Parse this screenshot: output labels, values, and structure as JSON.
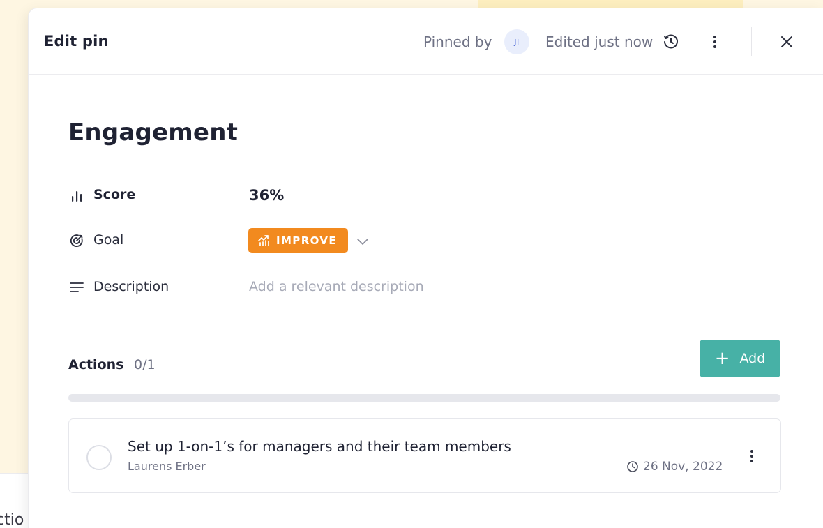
{
  "background": {
    "partial_text": "ctio"
  },
  "header": {
    "title": "Edit pin",
    "pinned_by_label": "Pinned by",
    "avatar_initials": "JI",
    "edited_label": "Edited just now"
  },
  "pin": {
    "title": "Engagement",
    "score_label": "Score",
    "score_value": "36%",
    "goal_label": "Goal",
    "goal_value": "IMPROVE",
    "description_label": "Description",
    "description_placeholder": "Add a relevant description"
  },
  "actions": {
    "label": "Actions",
    "count": "0/1",
    "add_label": "Add",
    "progress": 0,
    "items": [
      {
        "title": "Set up 1-on-1’s for managers and their team members",
        "owner": "Laurens Erber",
        "due": "26 Nov, 2022"
      }
    ]
  },
  "colors": {
    "accent": "#47b1a6",
    "goal_badge": "#f28a1f",
    "background_yellow": "#fef6e2"
  }
}
